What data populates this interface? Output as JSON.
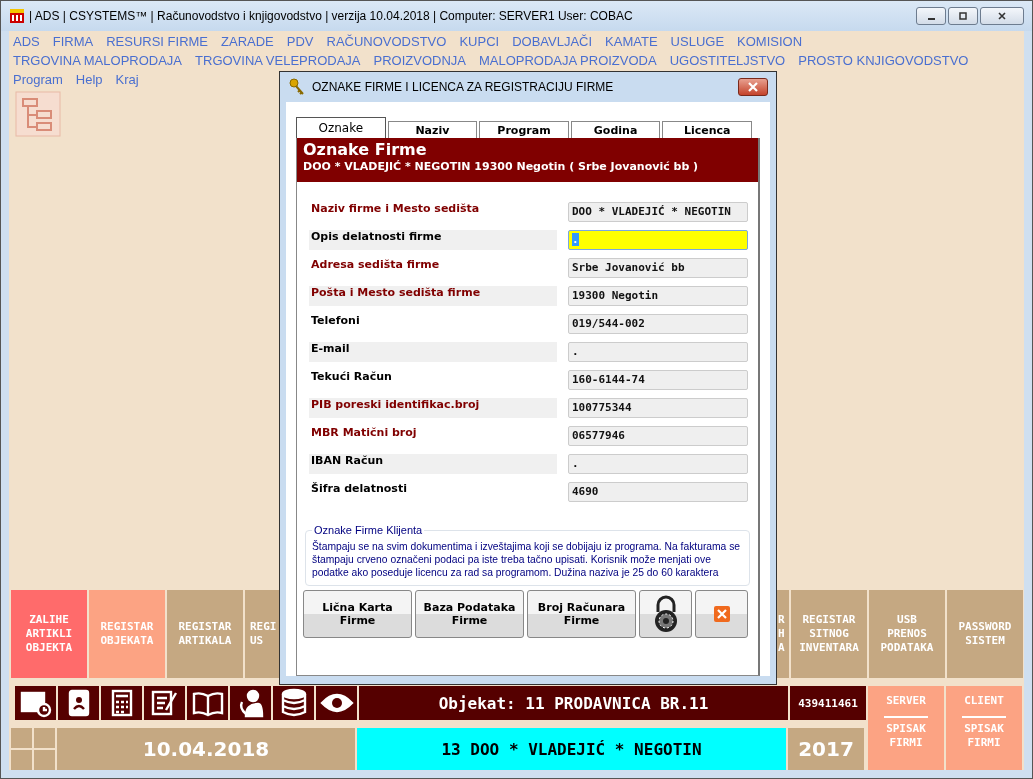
{
  "window": {
    "title": "| ADS | CSYSTEMS™ | Računovodstvo i knjigovodstvo |   verzija 10.04.2018  |  Computer: SERVER1  User: COBAC"
  },
  "menu_rows": [
    [
      "ADS",
      "FIRMA",
      "RESURSI FIRME",
      "ZARADE",
      "PDV",
      "RAČUNOVODSTVO",
      "KUPCI",
      "DOBAVLJAČI",
      "KAMATE",
      "USLUGE",
      "KOMISION"
    ],
    [
      "TRGOVINA MALOPRODAJA",
      "TRGOVINA VELEPRODAJA",
      "PROIZVODNJA",
      "MALOPRODAJA PROIZVODA",
      "UGOSTITELJSTVO",
      "PROSTO KNJIGOVODSTVO"
    ],
    [
      "Program",
      "Help",
      "Kraj"
    ]
  ],
  "tiles": [
    {
      "lines": [
        "ZALIHE",
        "ARTIKLI",
        "OBJEKTA"
      ],
      "color": "#ff6b6b"
    },
    {
      "lines": [
        "REGISTAR",
        "OBJEKATA"
      ],
      "color": "#fca383"
    },
    {
      "lines": [
        "REGISTAR",
        "ARTIKALA"
      ],
      "color": "#c5a882"
    },
    {
      "lines": [
        "REGI",
        "US"
      ],
      "color": "#c5a882"
    },
    {
      "lines": [
        "R",
        "H",
        "A"
      ],
      "color": "#c5a882"
    },
    {
      "lines": [
        "REGISTAR",
        "SITNOG",
        "INVENTARA"
      ],
      "color": "#c5a882"
    },
    {
      "lines": [
        "USB",
        "PRENOS",
        "PODATAKA"
      ],
      "color": "#c5a882"
    },
    {
      "lines": [
        "PASSWORD",
        "SISTEM"
      ],
      "color": "#c5a882"
    }
  ],
  "status": {
    "objekat": "Objekat: 11  PRODAVNICA BR.11",
    "code": "439411461",
    "date": "10.04.2018",
    "firm": "13  DOO * VLADEJIĆ * NEGOTIN",
    "year": "2017"
  },
  "side_tiles": [
    {
      "top": "SERVER",
      "bottom": [
        "SPISAK",
        "FIRMI"
      ]
    },
    {
      "top": "CLIENT",
      "bottom": [
        "SPISAK",
        "FIRMI"
      ]
    }
  ],
  "dialog": {
    "title": "OZNAKE FIRME I LICENCA ZA REGISTRACIJU FIRME",
    "tabs": [
      {
        "label": "Oznake",
        "selected": true
      },
      {
        "label": "Naziv",
        "selected": false
      },
      {
        "label": "Program",
        "selected": false
      },
      {
        "label": "Godina",
        "selected": false
      },
      {
        "label": "Licenca",
        "selected": false
      }
    ],
    "header": {
      "title": "Oznake Firme",
      "subtitle": "DOO * VLADEJIĆ * NEGOTIN 19300 Negotin ( Srbe Jovanović bb )"
    },
    "fields": [
      {
        "label": "Naziv firme i Mesto sedišta",
        "value": "DOO * VLADEJIĆ * NEGOTIN",
        "required": true,
        "focused": false
      },
      {
        "label": "Opis delatnosti firme",
        "value": ".",
        "required": false,
        "focused": true
      },
      {
        "label": "Adresa sedišta firme",
        "value": "Srbe Jovanović bb",
        "required": true,
        "focused": false
      },
      {
        "label": "Pošta i Mesto sedišta firme",
        "value": "19300 Negotin",
        "required": true,
        "focused": false
      },
      {
        "label": "Telefoni",
        "value": "019/544-002",
        "required": false,
        "focused": false
      },
      {
        "label": "E-mail",
        "value": ".",
        "required": false,
        "focused": false
      },
      {
        "label": "Tekući Račun",
        "value": "160-6144-74",
        "required": false,
        "focused": false
      },
      {
        "label": "PIB poreski identifikac.broj",
        "value": "100775344",
        "required": true,
        "focused": false
      },
      {
        "label": "MBR Matični broj",
        "value": "06577946",
        "required": true,
        "focused": false
      },
      {
        "label": "IBAN Račun",
        "value": ".",
        "required": false,
        "focused": false
      },
      {
        "label": "Šifra delatnosti",
        "value": "4690",
        "required": false,
        "focused": false
      }
    ],
    "group": {
      "title": "Oznake Firme Klijenta",
      "text": "Štampaju se na svim dokumentima i izveštajima koji se dobijaju iz programa. Na fakturama se štampaju crveno označeni podaci pa iste treba tačno upisati. Korisnik može menjati ove podatke ako poseduje licencu za rad sa programom. Dužina naziva je 25 do 60 karaktera"
    },
    "buttons": [
      {
        "kind": "text",
        "lines": [
          "Lična Karta",
          "Firme"
        ]
      },
      {
        "kind": "text",
        "lines": [
          "Baza Podataka",
          "Firme"
        ]
      },
      {
        "kind": "text",
        "lines": [
          "Broj Računara",
          "Firme"
        ]
      },
      {
        "kind": "lock"
      },
      {
        "kind": "close"
      }
    ]
  }
}
